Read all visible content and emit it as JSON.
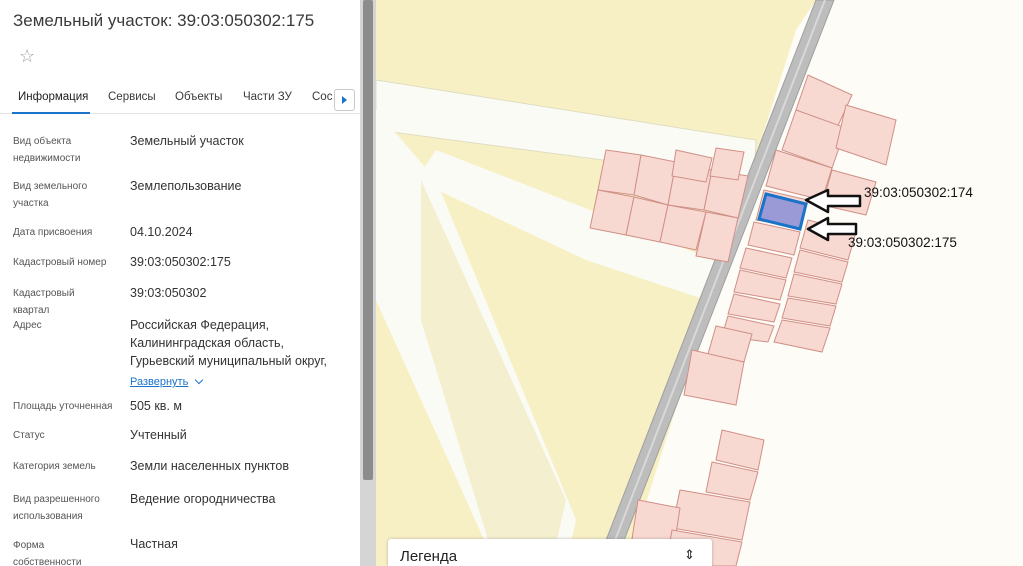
{
  "panel": {
    "title": "Земельный участок: 39:03:050302:175",
    "star_icon": "star-icon",
    "tabs": [
      {
        "label": "Информация",
        "active": true
      },
      {
        "label": "Сервисы"
      },
      {
        "label": "Объекты"
      },
      {
        "label": "Части ЗУ"
      },
      {
        "label": "Сос"
      }
    ],
    "rows": [
      {
        "label": "Вид объекта недвижимости",
        "value": "Земельный участок"
      },
      {
        "label": "Вид земельного участка",
        "value": "Землепользование"
      },
      {
        "label": "Дата присвоения",
        "value": "04.10.2024"
      },
      {
        "label": "Кадастровый номер",
        "value": "39:03:050302:175"
      },
      {
        "label": "Кадастровый квартал",
        "value": "39:03:050302"
      },
      {
        "label": "Адрес",
        "value_lines": [
          "Российская Федерация,",
          "Калининградская область,",
          "Гурьевский муниципальный округ,"
        ],
        "link": "Развернуть"
      },
      {
        "label": "Площадь уточненная",
        "value": "505 кв. м"
      },
      {
        "label": "Статус",
        "value": "Учтенный"
      },
      {
        "label": "Категория земель",
        "value": "Земли населенных пунктов"
      },
      {
        "label": "Вид разрешенного использования",
        "value": "Ведение огородничества"
      },
      {
        "label": "Форма собственности",
        "value": "Частная"
      }
    ]
  },
  "map": {
    "annotations": [
      "39:03:050302:174",
      "39:03:050302:175"
    ],
    "legend": {
      "label": "Легенда",
      "toggle_icon": "sort-arrows-icon",
      "toggle_glyph": "⇕"
    },
    "colors": {
      "background": "#f8f0c5",
      "parcel_fill": "#f7d9d2",
      "parcel_stroke": "#d08f86",
      "selected_fill": "#9a9ad6",
      "selected_stroke": "#1a73c8",
      "road": "#bdbdbd"
    }
  }
}
